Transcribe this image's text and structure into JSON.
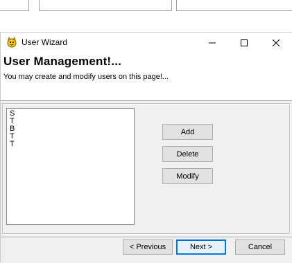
{
  "window": {
    "title": "User Wizard",
    "caption_buttons": [
      "minimize-icon",
      "maximize-icon",
      "close-icon"
    ]
  },
  "header": {
    "title": "User Management!...",
    "subtitle": "You may create and modify users on this page!..."
  },
  "users": {
    "items": [
      "S",
      "T",
      "B",
      "T",
      "T"
    ]
  },
  "actions": {
    "add_label": "Add",
    "delete_label": "Delete",
    "modify_label": "Modify"
  },
  "navigation": {
    "previous_label": "< Previous",
    "next_label": "Next >",
    "cancel_label": "Cancel"
  },
  "colors": {
    "dialog_body": "#f0f0f0",
    "button_face": "#e1e1e1",
    "focus_accent": "#0078d7",
    "app_icon": "#f2c811"
  }
}
